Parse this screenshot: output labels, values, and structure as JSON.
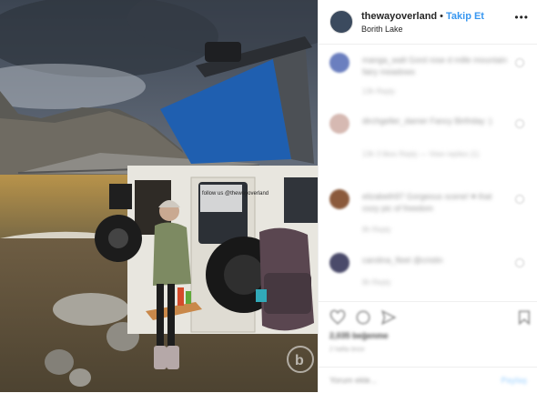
{
  "post": {
    "username": "thewayoverland",
    "separator": "•",
    "follow_label": "Takip Et",
    "location": "Borith Lake",
    "more_label": "•••"
  },
  "comments": [
    {
      "text": "manga_walt Gord rose d mille mountain fairy meadows",
      "meta": "13h  Reply",
      "avatar_color": "#6b7fbf"
    },
    {
      "text": "dirchgeller_damer Fancy Birthday :)",
      "meta": "13h  3 likes  Reply  — View replies (1)",
      "avatar_color": "#d6b9b2"
    },
    {
      "text": "elizabeth97 Gorgeous scene! ♥ that cozy pic of freedom",
      "meta": "8h  Reply",
      "avatar_color": "#8b5a3c"
    },
    {
      "text": "carolina_fleet @cristin",
      "meta": "8h  Reply",
      "avatar_color": "#4a4a6a"
    }
  ],
  "actions": {
    "likes": "2,035 beğenme",
    "time": "2 hafta önce",
    "add_comment_placeholder": "Yorum ekle...",
    "post_label": "Paylaş"
  },
  "photo": {
    "sticker_text": "follow us @thewayoverland",
    "watermark": "b"
  }
}
